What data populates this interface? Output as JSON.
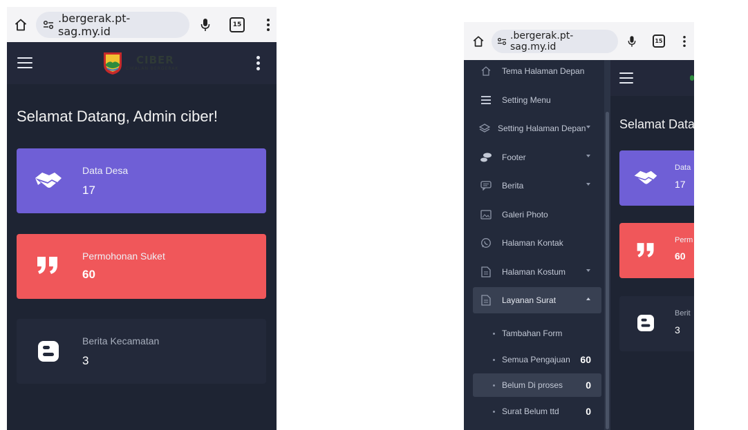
{
  "left_phone": {
    "browser": {
      "url": ".bergerak.pt-sag.my.id",
      "tab_count": "15"
    },
    "logo": {
      "text": "CIBER",
      "subtitle": "CIKALAN BERGERAK"
    },
    "welcome": "Selamat Datang, Admin ciber!",
    "cards": [
      {
        "label": "Data Desa",
        "value": "17",
        "color": "#6f5fd6",
        "icon": "handshake-icon"
      },
      {
        "label": "Permohonan Suket",
        "value": "60",
        "color": "#f0575a",
        "icon": "quote-icon"
      },
      {
        "label": "Berita Kecamatan",
        "value": "3",
        "color": "#23293a",
        "icon": "blogger-icon"
      }
    ]
  },
  "right_phone": {
    "browser": {
      "url": ".bergerak.pt-sag.my.id",
      "tab_count": "15"
    },
    "sidebar": {
      "items": [
        {
          "label": "Tema Halaman Depan",
          "icon": "home-icon",
          "has_caret": false
        },
        {
          "label": "Setting Menu",
          "icon": "menu-lines-icon",
          "has_caret": false
        },
        {
          "label": "Setting Halaman Depan",
          "icon": "layers-icon",
          "has_caret": true
        },
        {
          "label": "Footer",
          "icon": "shoe-print-icon",
          "has_caret": true
        },
        {
          "label": "Berita",
          "icon": "message-icon",
          "has_caret": true
        },
        {
          "label": "Galeri Photo",
          "icon": "image-icon",
          "has_caret": false
        },
        {
          "label": "Halaman Kontak",
          "icon": "whatsapp-icon",
          "has_caret": false
        },
        {
          "label": "Halaman Kostum",
          "icon": "document-icon",
          "has_caret": true
        },
        {
          "label": "Layanan Surat",
          "icon": "document-icon",
          "has_caret": true,
          "expanded": true
        }
      ],
      "subitems": [
        {
          "label": "Tambahan Form",
          "count": ""
        },
        {
          "label": "Semua Pengajuan",
          "count": "60"
        },
        {
          "label": "Belum Di proses",
          "count": "0"
        },
        {
          "label": "Surat Belum ttd",
          "count": "0"
        }
      ]
    },
    "welcome_partial": "Selamat Data",
    "cards": [
      {
        "label": "Data",
        "value": "17",
        "color": "#6f5fd6"
      },
      {
        "label": "Perm",
        "value": "60",
        "color": "#f0575a"
      },
      {
        "label": "Berit",
        "value": "3",
        "color": "#23293a"
      }
    ]
  }
}
